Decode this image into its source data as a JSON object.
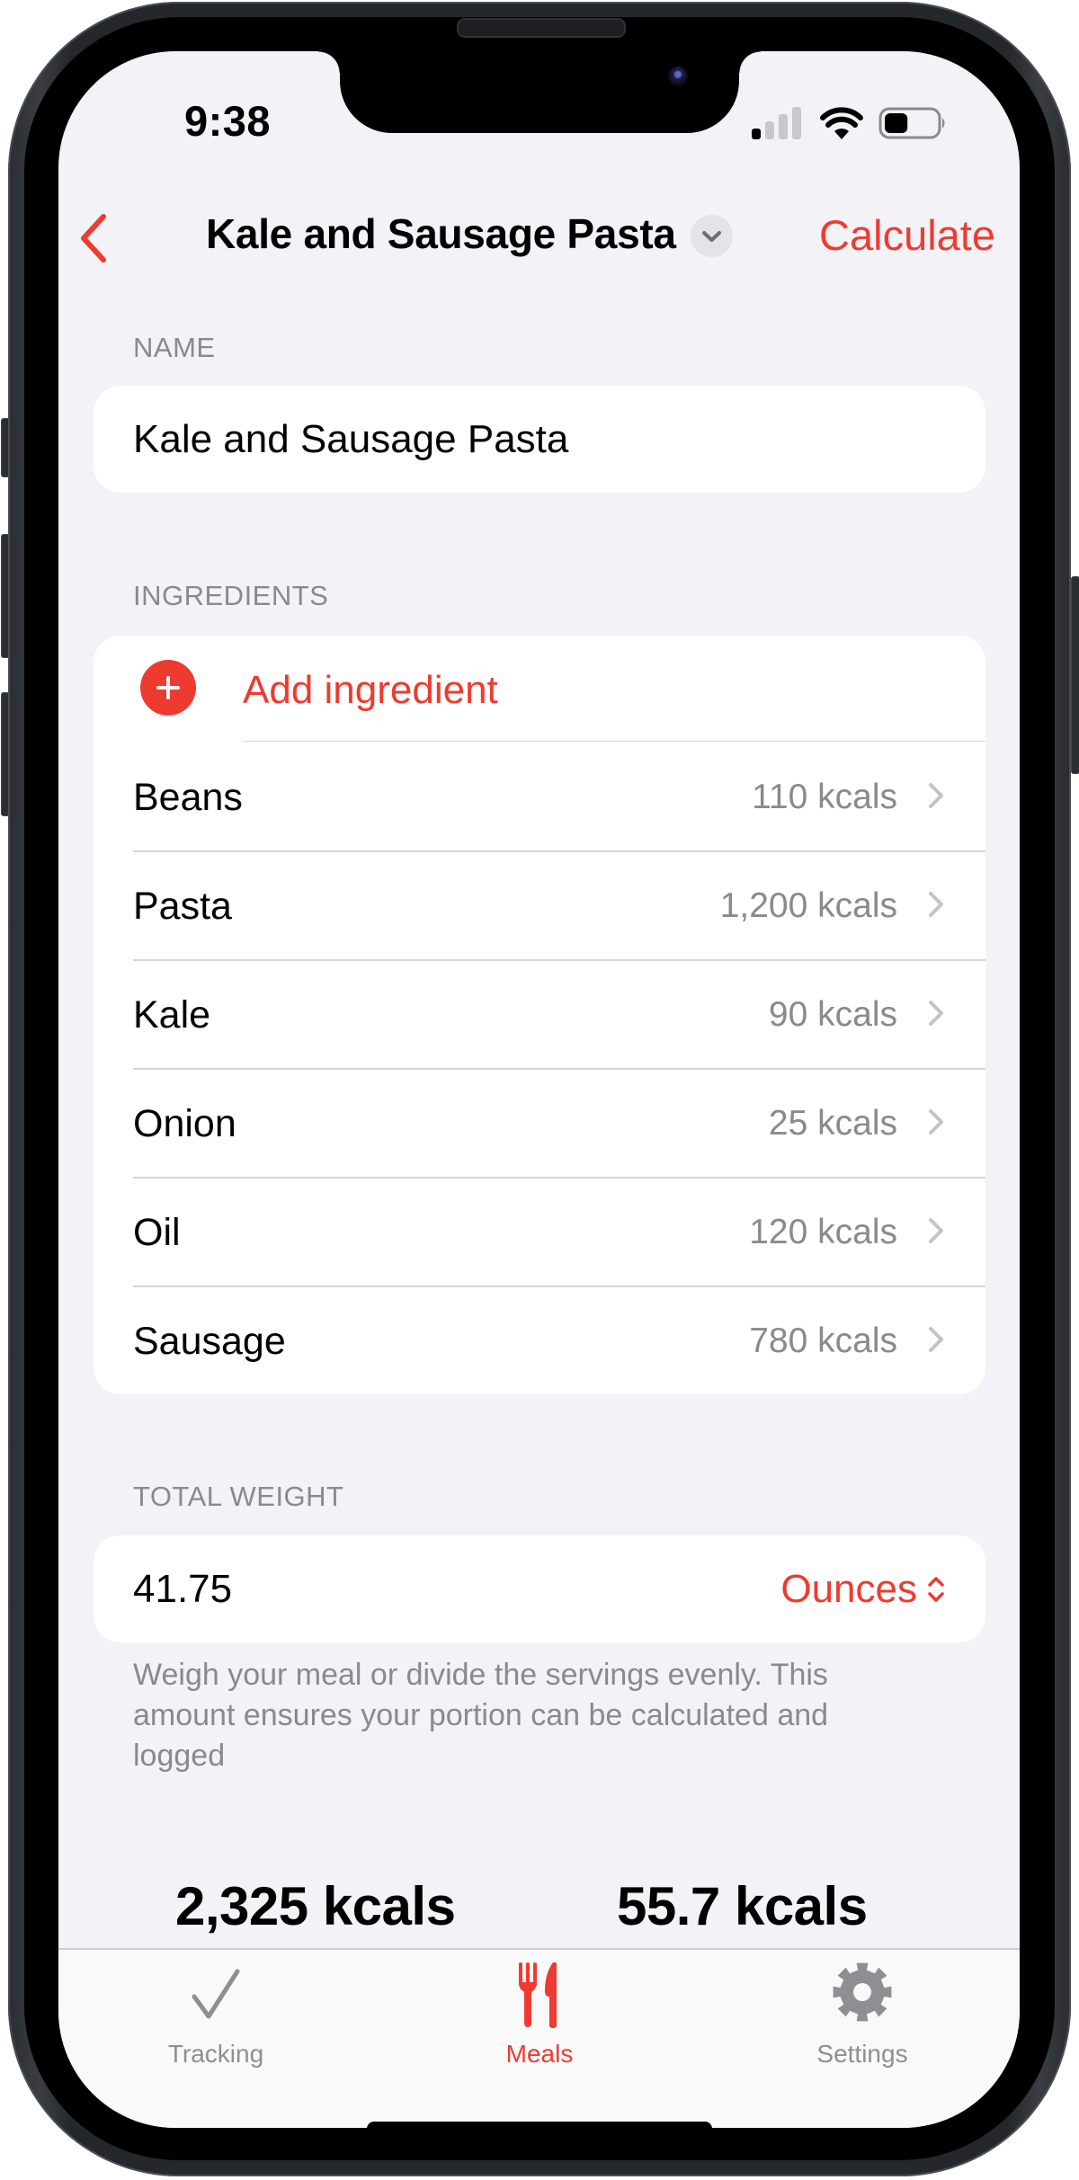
{
  "status_bar": {
    "time": "9:38",
    "signal_bars_active": 1,
    "signal_bars_total": 4,
    "battery_level": 0.45
  },
  "nav": {
    "back_icon": "chevron-left-icon",
    "title": "Kale and Sausage Pasta",
    "title_menu_icon": "chevron-down-circle-icon",
    "action_label": "Calculate"
  },
  "name_section": {
    "header": "NAME",
    "value": "Kale and Sausage Pasta"
  },
  "ingredients_section": {
    "header": "INGREDIENTS",
    "add_label": "Add ingredient",
    "add_icon": "plus-circle-icon",
    "items": [
      {
        "name": "Beans",
        "kcals": "110 kcals"
      },
      {
        "name": "Pasta",
        "kcals": "1,200 kcals"
      },
      {
        "name": "Kale",
        "kcals": "90 kcals"
      },
      {
        "name": "Onion",
        "kcals": "25 kcals"
      },
      {
        "name": "Oil",
        "kcals": "120 kcals"
      },
      {
        "name": "Sausage",
        "kcals": "780 kcals"
      }
    ]
  },
  "weight_section": {
    "header": "TOTAL WEIGHT",
    "value": "41.75",
    "unit": "Ounces",
    "unit_icon": "chevron-up-down-icon",
    "footnote": "Weigh your meal or divide the servings evenly. This amount ensures your portion can be calculated and logged"
  },
  "summary": {
    "total": "2,325 kcals",
    "portion": "55.7 kcals"
  },
  "tab_bar": {
    "tabs": [
      {
        "label": "Tracking",
        "icon": "checkmark-icon",
        "active": false
      },
      {
        "label": "Meals",
        "icon": "fork-knife-icon",
        "active": true
      },
      {
        "label": "Settings",
        "icon": "gear-icon",
        "active": false
      }
    ]
  },
  "colors": {
    "accent": "#EE3B30",
    "secondary_text": "#8A8A8E",
    "background": "#F2F2F7",
    "inactive_tab": "#8E8E93"
  }
}
